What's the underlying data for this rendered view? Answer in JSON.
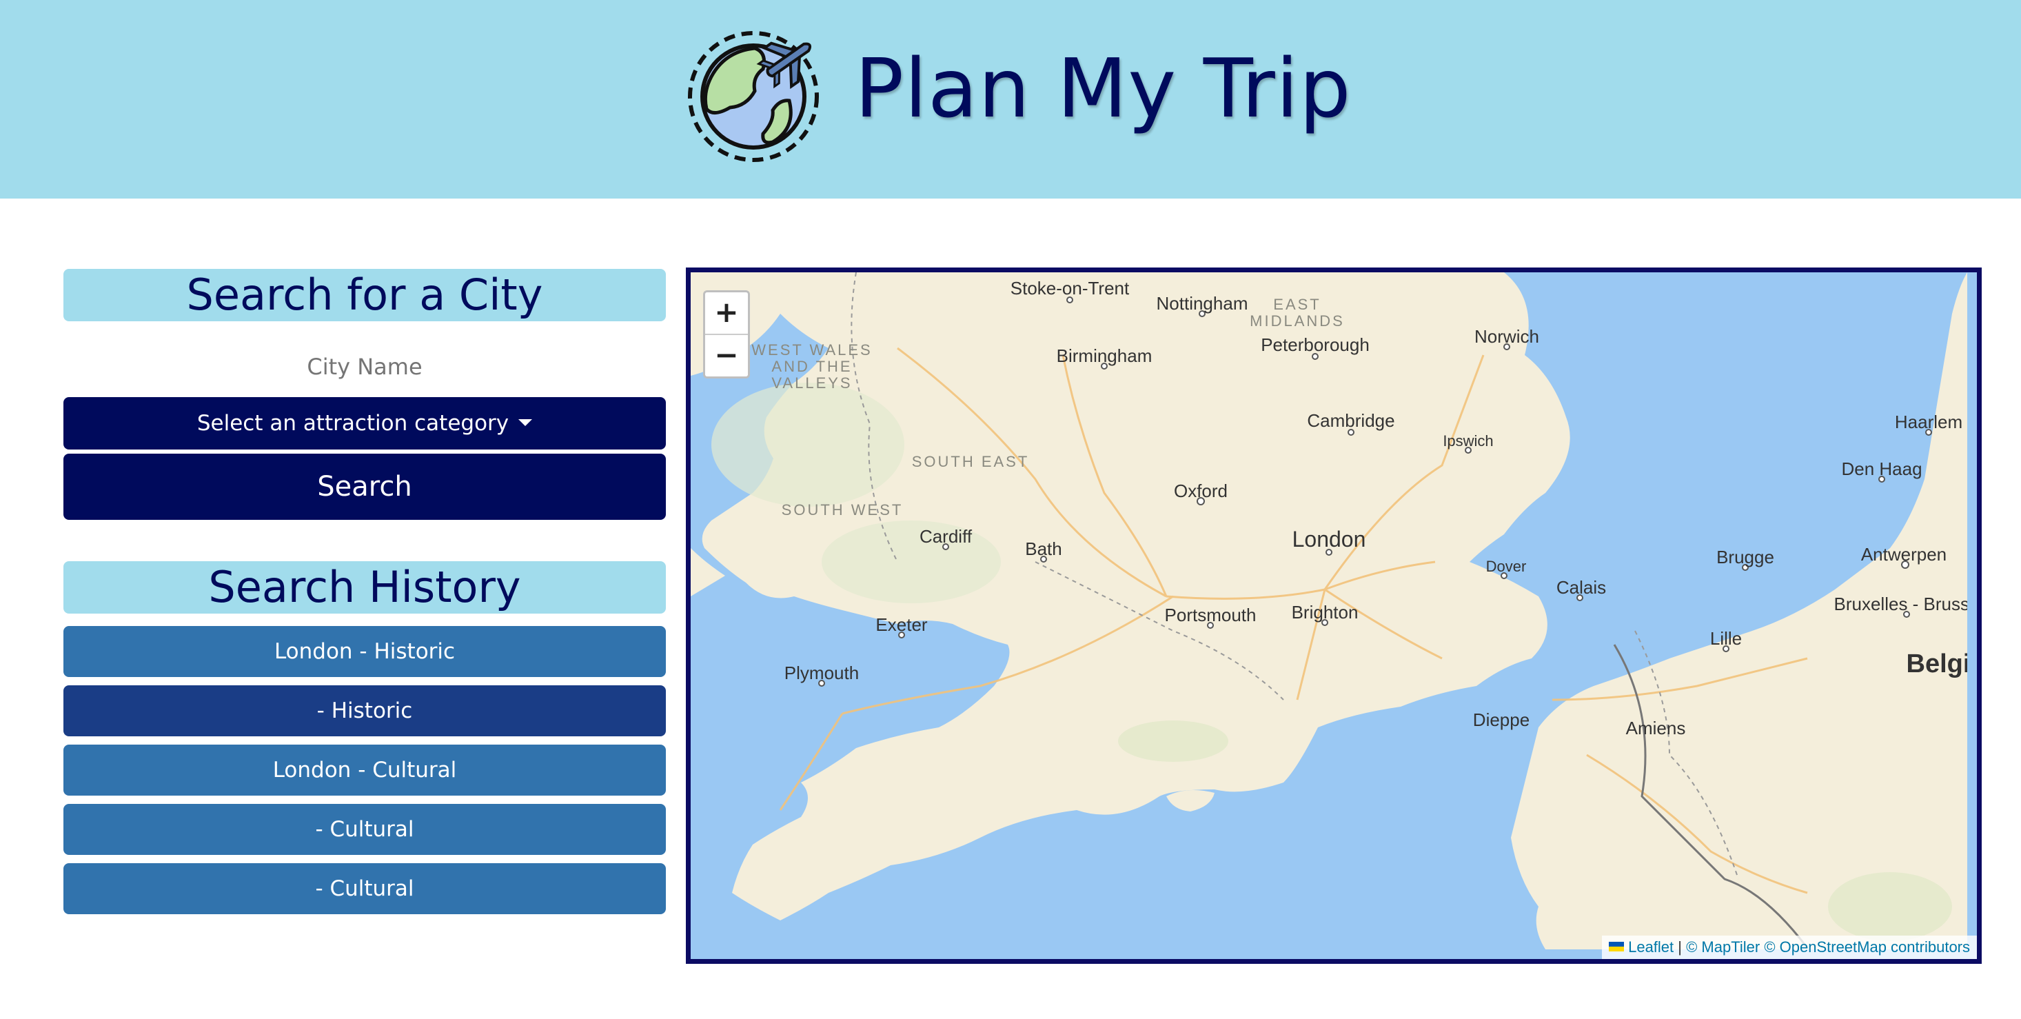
{
  "header": {
    "title": "Plan My Trip",
    "logo_icon": "globe-airplane-icon"
  },
  "search": {
    "heading": "Search for a City",
    "city_placeholder": "City Name",
    "category_label": "Select an attraction category",
    "search_label": "Search"
  },
  "history": {
    "heading": "Search History",
    "items": [
      {
        "label": "London - Historic"
      },
      {
        "label": "- Historic"
      },
      {
        "label": "London - Cultural"
      },
      {
        "label": "- Cultural"
      },
      {
        "label": "- Cultural"
      }
    ]
  },
  "map": {
    "zoom_in": "+",
    "zoom_out": "−",
    "attribution": {
      "leaflet": "Leaflet",
      "sep": " | ",
      "maptiler": "© MapTiler",
      "osm": "© OpenStreetMap contributors"
    },
    "cities": {
      "stoke": "Stoke-on-Trent",
      "nottingham": "Nottingham",
      "norwich": "Norwich",
      "birmingham": "Birmingham",
      "peterborough": "Peterborough",
      "cambridge": "Cambridge",
      "ipswich": "Ipswich",
      "oxford": "Oxford",
      "london": "London",
      "cardiff": "Cardiff",
      "bath": "Bath",
      "dover": "Dover",
      "calais": "Calais",
      "exeter": "Exeter",
      "portsmouth": "Portsmouth",
      "brighton": "Brighton",
      "plymouth": "Plymouth",
      "dieppe": "Dieppe",
      "amiens": "Amiens",
      "lille": "Lille",
      "brugge": "Brugge",
      "antwerpen": "Antwerpen",
      "bruxelles": "Bruxelles - Brusse",
      "belgie": "Belgi",
      "haarlem": "Haarlem",
      "den_haag": "Den Haag"
    },
    "regions": {
      "east_midlands_1": "EAST",
      "east_midlands_2": "MIDLANDS",
      "wales_1": "WEST WALES",
      "wales_2": "AND THE",
      "wales_3": "VALLEYS",
      "south_east": "SOUTH EAST",
      "south_west": "SOUTH WEST"
    }
  }
}
